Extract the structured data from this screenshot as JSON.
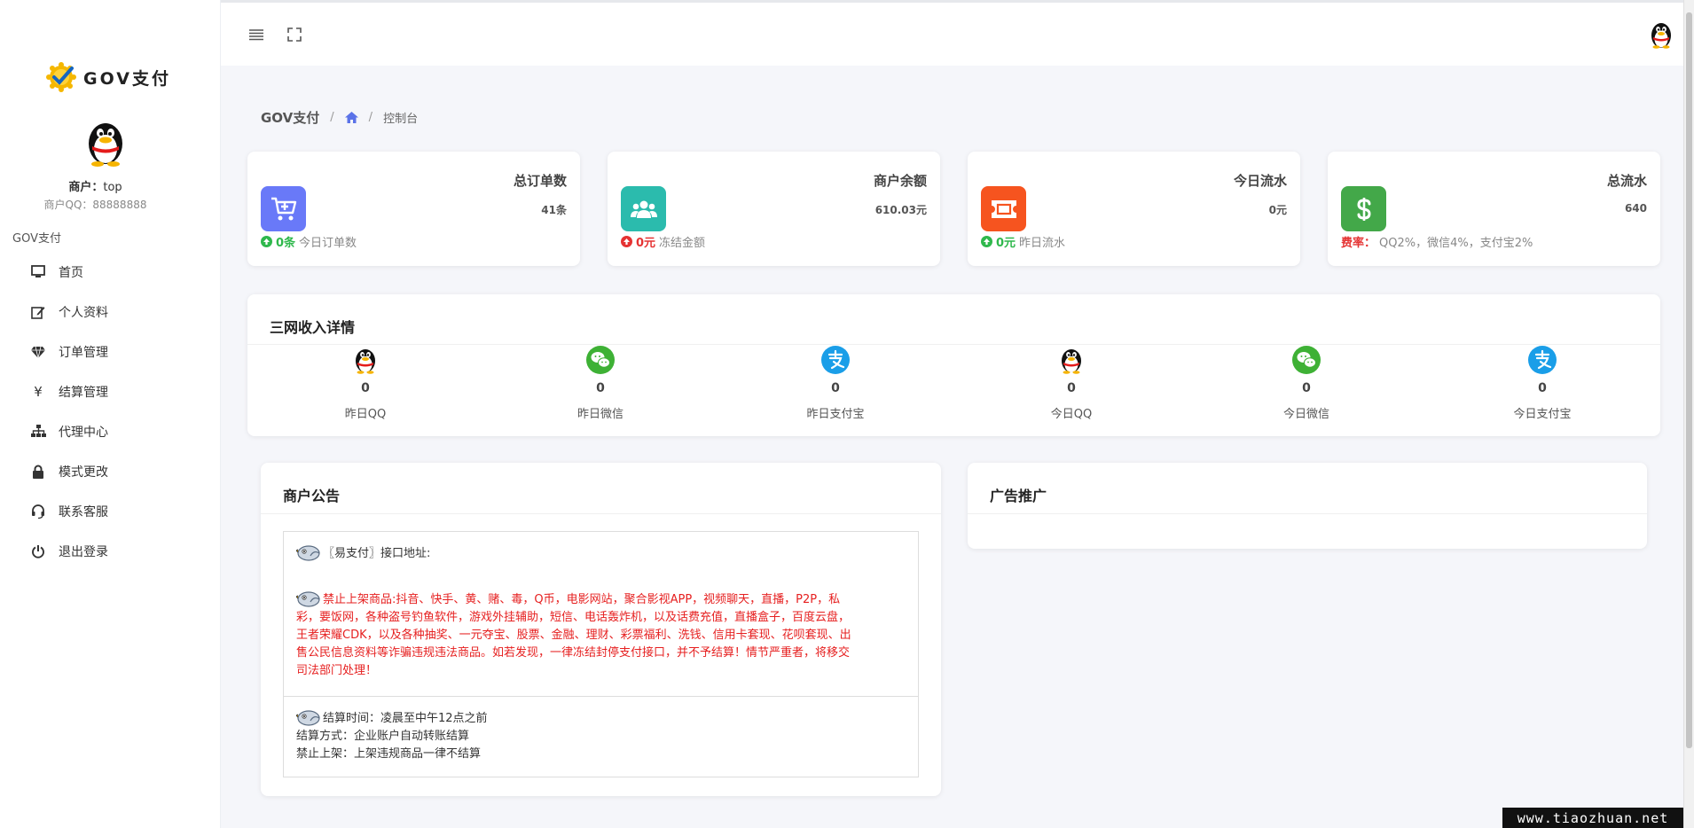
{
  "brand": {
    "name": "GOV支付"
  },
  "sidebar": {
    "merchant_label": "商户：",
    "merchant_name": "top",
    "merchant_qq": "商户QQ：88888888",
    "section": "GOV支付",
    "items": [
      {
        "label": "首页",
        "icon": "monitor-icon"
      },
      {
        "label": "个人资料",
        "icon": "edit-icon"
      },
      {
        "label": "订单管理",
        "icon": "diamond-icon"
      },
      {
        "label": "结算管理",
        "icon": "yen-icon"
      },
      {
        "label": "代理中心",
        "icon": "sitemap-icon"
      },
      {
        "label": "模式更改",
        "icon": "lock-icon"
      },
      {
        "label": "联系客服",
        "icon": "headset-icon"
      },
      {
        "label": "退出登录",
        "icon": "power-icon"
      }
    ]
  },
  "breadcrumb": {
    "root": "GOV支付",
    "current": "控制台"
  },
  "stats": [
    {
      "title": "总订单数",
      "value": "41条",
      "foot_value": "0条",
      "foot_label": "今日订单数",
      "color": "#6979f8",
      "trend": "up"
    },
    {
      "title": "商户余额",
      "value": "610.03元",
      "foot_value": "0元",
      "foot_label": "冻结金额",
      "color": "#2bbbad",
      "trend": "down"
    },
    {
      "title": "今日流水",
      "value": "0元",
      "foot_value": "0元",
      "foot_label": "昨日流水",
      "color": "#f6541f",
      "trend": "up"
    },
    {
      "title": "总流水",
      "value": "640",
      "foot_value": "费率：",
      "foot_label": "QQ2%，微信4%，支付宝2%",
      "color": "#43a849",
      "trend": "fee"
    }
  ],
  "income": {
    "title": "三网收入详情",
    "items": [
      {
        "label": "昨日QQ",
        "value": "0",
        "icon": "qq-icon"
      },
      {
        "label": "昨日微信",
        "value": "0",
        "icon": "wechat-icon"
      },
      {
        "label": "昨日支付宝",
        "value": "0",
        "icon": "alipay-icon"
      },
      {
        "label": "今日QQ",
        "value": "0",
        "icon": "qq-icon"
      },
      {
        "label": "今日微信",
        "value": "0",
        "icon": "wechat-icon"
      },
      {
        "label": "今日支付宝",
        "value": "0",
        "icon": "alipay-icon"
      }
    ]
  },
  "notice": {
    "title": "商户公告",
    "line1": "〖易支付〗接口地址:",
    "warning_lines": [
      "禁止上架商品:抖音、快手、黄、赌、毒，Q币，电影网站，聚合影视APP，视频聊天，直播，P2P，私",
      "彩，要饭网，各种盗号钓鱼软件，游戏外挂辅助，短信、电话轰炸机，以及话费充值，直播盒子，百度云盘，",
      "王者荣耀CDK，以及各种抽奖、一元夺宝、股票、金融、理财、彩票福利、洗钱、信用卡套现、花呗套现、出",
      "售公民信息资料等诈骗违规违法商品。如若发现，一律冻结封停支付接口，并不予结算！情节严重者，将移交",
      "司法部门处理！"
    ],
    "settle_time": "结算时间：凌晨至中午12点之前",
    "settle_method": "结算方式：企业账户自动转账结算",
    "settle_ban": "禁止上架：上架违规商品一律不结算"
  },
  "ads": {
    "title": "广告推广"
  },
  "watermark": "www.tiaozhuan.net"
}
